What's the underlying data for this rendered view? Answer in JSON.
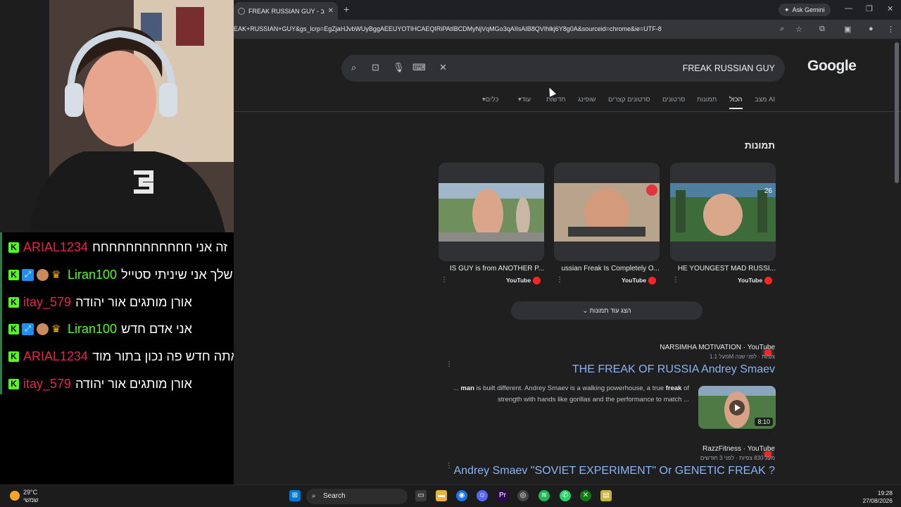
{
  "browser": {
    "tab_title": "FREAK RUSSIAN GUY - חיפוש ב",
    "new_tab": "+",
    "ask_gemini": "Ask Gemini",
    "url": "EAK+RUSSIAN+GUY&gs_lcrp=EgZjaHJvbWUyBggAEEUYOTIHCAEQIRiPAtIBCDMyNjVqMGo3qAIIsAIB8QVIhlkj6Y8g0A&sourceid=chrome&ie=UTF-8"
  },
  "google": {
    "logo": "Google",
    "query": "FREAK RUSSIAN GUY",
    "tabs": [
      "מצב AI",
      "הכול",
      "תמונות",
      "סרטונים",
      "סרטונים קצרים",
      "שופינג",
      "חדשות",
      "עוד",
      "כלים"
    ],
    "active_tab": "הכול",
    "images_heading": "תמונות",
    "image_cards": [
      {
        "title": "HE YOUNGEST MAD RUSSI...",
        "source": "YouTube"
      },
      {
        "title": "ussian Freak Is Completely O...",
        "source": "YouTube"
      },
      {
        "title": "IS GUY is from ANOTHER P...",
        "source": "YouTube"
      }
    ],
    "more_images": "הצג עוד תמונות",
    "results": [
      {
        "source": "NARSIMHA MOTIVATION · YouTube",
        "meta": "מעל 1.1M צפיות · לפני שנה",
        "title": "THE FREAK OF RUSSIA Andrey Smaev",
        "snippet_pre": "... ",
        "snippet_b1": "man",
        "snippet_mid": " is built different. Andrey Smaev is a walking powerhouse, a true ",
        "snippet_b2": "freak",
        "snippet_post": " of strength with hands like gorillas and the performance to match ...",
        "duration": "8:10"
      },
      {
        "source": "RazzFitness · YouTube",
        "meta": "מעל 830 צפיות · לפני 3 חודשים",
        "title": "Andrey Smaev \"SOVIET EXPERIMENT\" Or GENETIC FREAK ?"
      }
    ]
  },
  "chat": [
    {
      "user": "ARIAL1234",
      "color": "#e8264a",
      "message": "זה אני חחחחחחחחחחחח",
      "badges": [
        "k"
      ]
    },
    {
      "user": "Liran100",
      "color": "#53fc18",
      "message": "כוסאמא שלך אני שיניתי סטייל",
      "badges": [
        "k",
        "sub",
        "face",
        "crown"
      ]
    },
    {
      "user": "itay_579",
      "color": "#e8264a",
      "message": "אורן מותגים אור יהודה",
      "badges": [
        "k"
      ]
    },
    {
      "user": "Liran100",
      "color": "#53fc18",
      "message": "אני אדם חדש",
      "badges": [
        "k",
        "sub",
        "face",
        "crown"
      ]
    },
    {
      "user": "ARIAL1234",
      "color": "#e8264a",
      "message": "ליעד אתה חדש פה נכון בתור מוד",
      "badges": [
        "k"
      ]
    },
    {
      "user": "itay_579",
      "color": "#e8264a",
      "message": "אורן מותגים אור יהודה",
      "badges": [
        "k"
      ]
    }
  ],
  "taskbar": {
    "temp": "29°C",
    "weather": "שמשי",
    "search": "Search",
    "time": "19:28",
    "date": "27/08/2026"
  }
}
